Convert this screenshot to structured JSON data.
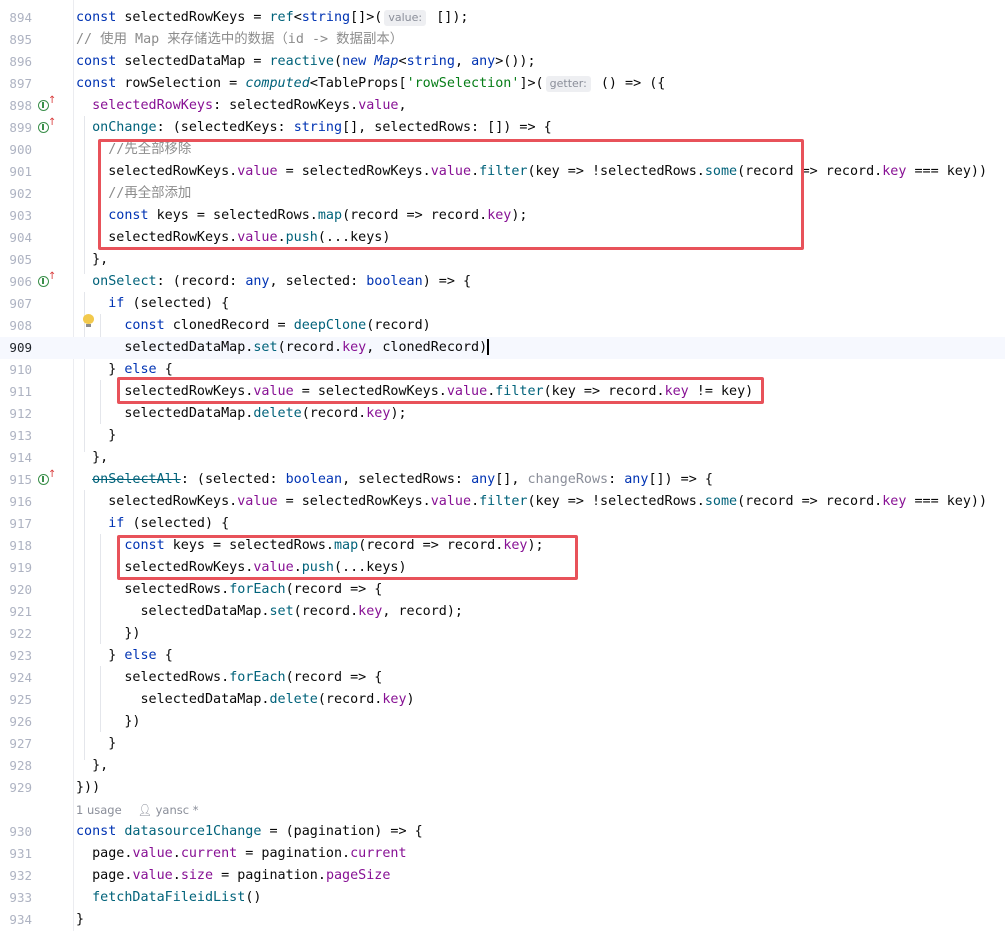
{
  "editor": {
    "lines": [
      {
        "n": "894",
        "segs": [
          [
            "const ",
            "kw"
          ],
          [
            "selectedRowKeys = ",
            ""
          ],
          [
            "ref",
            "fn"
          ],
          [
            "<",
            ""
          ],
          [
            "string",
            "kw"
          ],
          [
            "[]>(",
            ""
          ],
          [
            "value:",
            "hint"
          ],
          [
            " []);",
            ""
          ]
        ]
      },
      {
        "n": "895",
        "segs": [
          [
            "// 使用 Map 来存储选中的数据（id -> 数据副本）",
            "cm"
          ]
        ]
      },
      {
        "n": "896",
        "segs": [
          [
            "const ",
            "kw"
          ],
          [
            "selectedDataMap = ",
            ""
          ],
          [
            "reactive",
            "fn"
          ],
          [
            "(",
            ""
          ],
          [
            "new ",
            "kw"
          ],
          [
            "Map",
            "type it"
          ],
          [
            "<",
            ""
          ],
          [
            "string",
            "kw"
          ],
          [
            ", ",
            ""
          ],
          [
            "any",
            "kw"
          ],
          [
            ">());",
            ""
          ]
        ]
      },
      {
        "n": "897",
        "segs": [
          [
            "const ",
            "kw"
          ],
          [
            "rowSelection = ",
            ""
          ],
          [
            "computed",
            "fn it"
          ],
          [
            "<TableProps[",
            ""
          ],
          [
            "'rowSelection'",
            "str"
          ],
          [
            "]>(",
            ""
          ],
          [
            "getter:",
            "hint"
          ],
          [
            " () => ({",
            ""
          ]
        ]
      },
      {
        "n": "898",
        "icon": true,
        "segs": [
          [
            "  ",
            ""
          ],
          [
            "selectedRowKeys",
            "prop"
          ],
          [
            ": selectedRowKeys.",
            ""
          ],
          [
            "value",
            "prop"
          ],
          [
            ",",
            ""
          ]
        ]
      },
      {
        "n": "899",
        "icon": true,
        "segs": [
          [
            "  ",
            ""
          ],
          [
            "onChange",
            "cyan"
          ],
          [
            ": (selectedKeys: ",
            ""
          ],
          [
            "string",
            "kw"
          ],
          [
            "[], selectedRows: []) => {",
            ""
          ]
        ]
      },
      {
        "n": "900",
        "segs": [
          [
            "    ",
            ""
          ],
          [
            "//先全部移除",
            "cm"
          ]
        ]
      },
      {
        "n": "901",
        "segs": [
          [
            "    selectedRowKeys.",
            ""
          ],
          [
            "value",
            "prop"
          ],
          [
            " = selectedRowKeys.",
            ""
          ],
          [
            "value",
            "prop"
          ],
          [
            ".",
            ""
          ],
          [
            "filter",
            "fn"
          ],
          [
            "(key => !selectedRows.",
            ""
          ],
          [
            "some",
            "fn"
          ],
          [
            "(record => record.",
            ""
          ],
          [
            "key",
            "prop"
          ],
          [
            " === key))",
            ""
          ]
        ]
      },
      {
        "n": "902",
        "segs": [
          [
            "    ",
            ""
          ],
          [
            "//再全部添加",
            "cm"
          ]
        ]
      },
      {
        "n": "903",
        "segs": [
          [
            "    ",
            ""
          ],
          [
            "const ",
            "kw"
          ],
          [
            "keys = selectedRows.",
            ""
          ],
          [
            "map",
            "fn"
          ],
          [
            "(record => record.",
            ""
          ],
          [
            "key",
            "prop"
          ],
          [
            ");",
            ""
          ]
        ]
      },
      {
        "n": "904",
        "segs": [
          [
            "    selectedRowKeys.",
            ""
          ],
          [
            "value",
            "prop"
          ],
          [
            ".",
            ""
          ],
          [
            "push",
            "fn"
          ],
          [
            "(...keys)",
            ""
          ]
        ]
      },
      {
        "n": "905",
        "segs": [
          [
            "  },",
            ""
          ]
        ]
      },
      {
        "n": "906",
        "icon": true,
        "segs": [
          [
            "  ",
            ""
          ],
          [
            "onSelect",
            "cyan"
          ],
          [
            ": (record: ",
            ""
          ],
          [
            "any",
            "kw"
          ],
          [
            ", selected: ",
            ""
          ],
          [
            "boolean",
            "kw"
          ],
          [
            ") => {",
            ""
          ]
        ]
      },
      {
        "n": "907",
        "segs": [
          [
            "    ",
            ""
          ],
          [
            "if ",
            "kw"
          ],
          [
            "(selected) {",
            ""
          ]
        ]
      },
      {
        "n": "908",
        "segs": [
          [
            "      ",
            ""
          ],
          [
            "const ",
            "kw"
          ],
          [
            "clonedRecord = ",
            ""
          ],
          [
            "deepClone",
            "fn"
          ],
          [
            "(record)",
            ""
          ]
        ]
      },
      {
        "n": "909",
        "current": true,
        "segs": [
          [
            "      selectedDataMap.",
            ""
          ],
          [
            "set",
            "fn"
          ],
          [
            "(record.",
            ""
          ],
          [
            "key",
            "prop"
          ],
          [
            ", clonedRecord)",
            ""
          ],
          [
            "",
            "caret"
          ]
        ]
      },
      {
        "n": "910",
        "segs": [
          [
            "    } ",
            ""
          ],
          [
            "else ",
            "kw"
          ],
          [
            "{",
            ""
          ]
        ]
      },
      {
        "n": "911",
        "segs": [
          [
            "      selectedRowKeys.",
            ""
          ],
          [
            "value",
            "prop"
          ],
          [
            " = selectedRowKeys.",
            ""
          ],
          [
            "value",
            "prop"
          ],
          [
            ".",
            ""
          ],
          [
            "filter",
            "fn"
          ],
          [
            "(key => record.",
            ""
          ],
          [
            "key",
            "prop"
          ],
          [
            " != key)",
            ""
          ]
        ]
      },
      {
        "n": "912",
        "segs": [
          [
            "      selectedDataMap.",
            ""
          ],
          [
            "delete",
            "fn"
          ],
          [
            "(record.",
            ""
          ],
          [
            "key",
            "prop"
          ],
          [
            ");",
            ""
          ]
        ]
      },
      {
        "n": "913",
        "segs": [
          [
            "    }",
            ""
          ]
        ]
      },
      {
        "n": "914",
        "segs": [
          [
            "  },",
            ""
          ]
        ]
      },
      {
        "n": "915",
        "icon": true,
        "segs": [
          [
            "  ",
            ""
          ],
          [
            "onSelectAll",
            "cyan strike"
          ],
          [
            ": (selected: ",
            ""
          ],
          [
            "boolean",
            "kw"
          ],
          [
            ", selectedRows: ",
            ""
          ],
          [
            "any",
            "kw"
          ],
          [
            "[], ",
            ""
          ],
          [
            "changeRows",
            "gray"
          ],
          [
            ": ",
            ""
          ],
          [
            "any",
            "kw"
          ],
          [
            "[]) => {",
            ""
          ]
        ]
      },
      {
        "n": "916",
        "segs": [
          [
            "    selectedRowKeys.",
            ""
          ],
          [
            "value",
            "prop"
          ],
          [
            " = selectedRowKeys.",
            ""
          ],
          [
            "value",
            "prop"
          ],
          [
            ".",
            ""
          ],
          [
            "filter",
            "fn"
          ],
          [
            "(key => !selectedRows.",
            ""
          ],
          [
            "some",
            "fn"
          ],
          [
            "(record => record.",
            ""
          ],
          [
            "key",
            "prop"
          ],
          [
            " === key))",
            ""
          ]
        ]
      },
      {
        "n": "917",
        "segs": [
          [
            "    ",
            ""
          ],
          [
            "if ",
            "kw"
          ],
          [
            "(selected) {",
            ""
          ]
        ]
      },
      {
        "n": "918",
        "segs": [
          [
            "      ",
            ""
          ],
          [
            "const ",
            "kw"
          ],
          [
            "keys = selectedRows.",
            ""
          ],
          [
            "map",
            "fn"
          ],
          [
            "(record => record.",
            ""
          ],
          [
            "key",
            "prop"
          ],
          [
            ");",
            ""
          ]
        ]
      },
      {
        "n": "919",
        "segs": [
          [
            "      selectedRowKeys.",
            ""
          ],
          [
            "value",
            "prop"
          ],
          [
            ".",
            ""
          ],
          [
            "push",
            "fn"
          ],
          [
            "(...keys)",
            ""
          ]
        ]
      },
      {
        "n": "920",
        "segs": [
          [
            "      selectedRows.",
            ""
          ],
          [
            "forEach",
            "fn"
          ],
          [
            "(record => {",
            ""
          ]
        ]
      },
      {
        "n": "921",
        "segs": [
          [
            "        selectedDataMap.",
            ""
          ],
          [
            "set",
            "fn"
          ],
          [
            "(record.",
            ""
          ],
          [
            "key",
            "prop"
          ],
          [
            ", record);",
            ""
          ]
        ]
      },
      {
        "n": "922",
        "segs": [
          [
            "      })",
            ""
          ]
        ]
      },
      {
        "n": "923",
        "segs": [
          [
            "    } ",
            ""
          ],
          [
            "else ",
            "kw"
          ],
          [
            "{",
            ""
          ]
        ]
      },
      {
        "n": "924",
        "segs": [
          [
            "      selectedRows.",
            ""
          ],
          [
            "forEach",
            "fn"
          ],
          [
            "(record => {",
            ""
          ]
        ]
      },
      {
        "n": "925",
        "segs": [
          [
            "        selectedDataMap.",
            ""
          ],
          [
            "delete",
            "fn"
          ],
          [
            "(record.",
            ""
          ],
          [
            "key",
            "prop"
          ],
          [
            ")",
            ""
          ]
        ]
      },
      {
        "n": "926",
        "segs": [
          [
            "      })",
            ""
          ]
        ]
      },
      {
        "n": "927",
        "segs": [
          [
            "    }",
            ""
          ]
        ]
      },
      {
        "n": "928",
        "segs": [
          [
            "  },",
            ""
          ]
        ]
      },
      {
        "n": "929",
        "segs": [
          [
            "}))",
            ""
          ]
        ]
      },
      {
        "n": "930",
        "segs": [
          [
            "const ",
            "kw"
          ],
          [
            "datasource1Change",
            "fn"
          ],
          [
            " = (pagination) => {",
            ""
          ]
        ]
      },
      {
        "n": "931",
        "segs": [
          [
            "  page.",
            ""
          ],
          [
            "value",
            "prop"
          ],
          [
            ".",
            ""
          ],
          [
            "current",
            "prop"
          ],
          [
            " = pagination.",
            ""
          ],
          [
            "current",
            "prop"
          ]
        ]
      },
      {
        "n": "932",
        "segs": [
          [
            "  page.",
            ""
          ],
          [
            "value",
            "prop"
          ],
          [
            ".",
            ""
          ],
          [
            "size",
            "prop"
          ],
          [
            " = pagination.",
            ""
          ],
          [
            "pageSize",
            "prop"
          ]
        ]
      },
      {
        "n": "933",
        "segs": [
          [
            "  ",
            ""
          ],
          [
            "fetchDataFileidList",
            "fn"
          ],
          [
            "()",
            ""
          ]
        ]
      },
      {
        "n": "934",
        "segs": [
          [
            "}",
            ""
          ]
        ]
      }
    ],
    "usage_hint": {
      "usages": "1 usage",
      "author": "yansc *"
    }
  },
  "colors": {
    "keyword": "#0033b3",
    "function": "#00627a",
    "property": "#871094",
    "string": "#067d17",
    "comment": "#8c8c8c",
    "highlight_box": "#e8525a"
  },
  "icons": {
    "gutter_override": "implements-method-icon",
    "intention": "lightbulb-icon",
    "author": "person-icon"
  }
}
